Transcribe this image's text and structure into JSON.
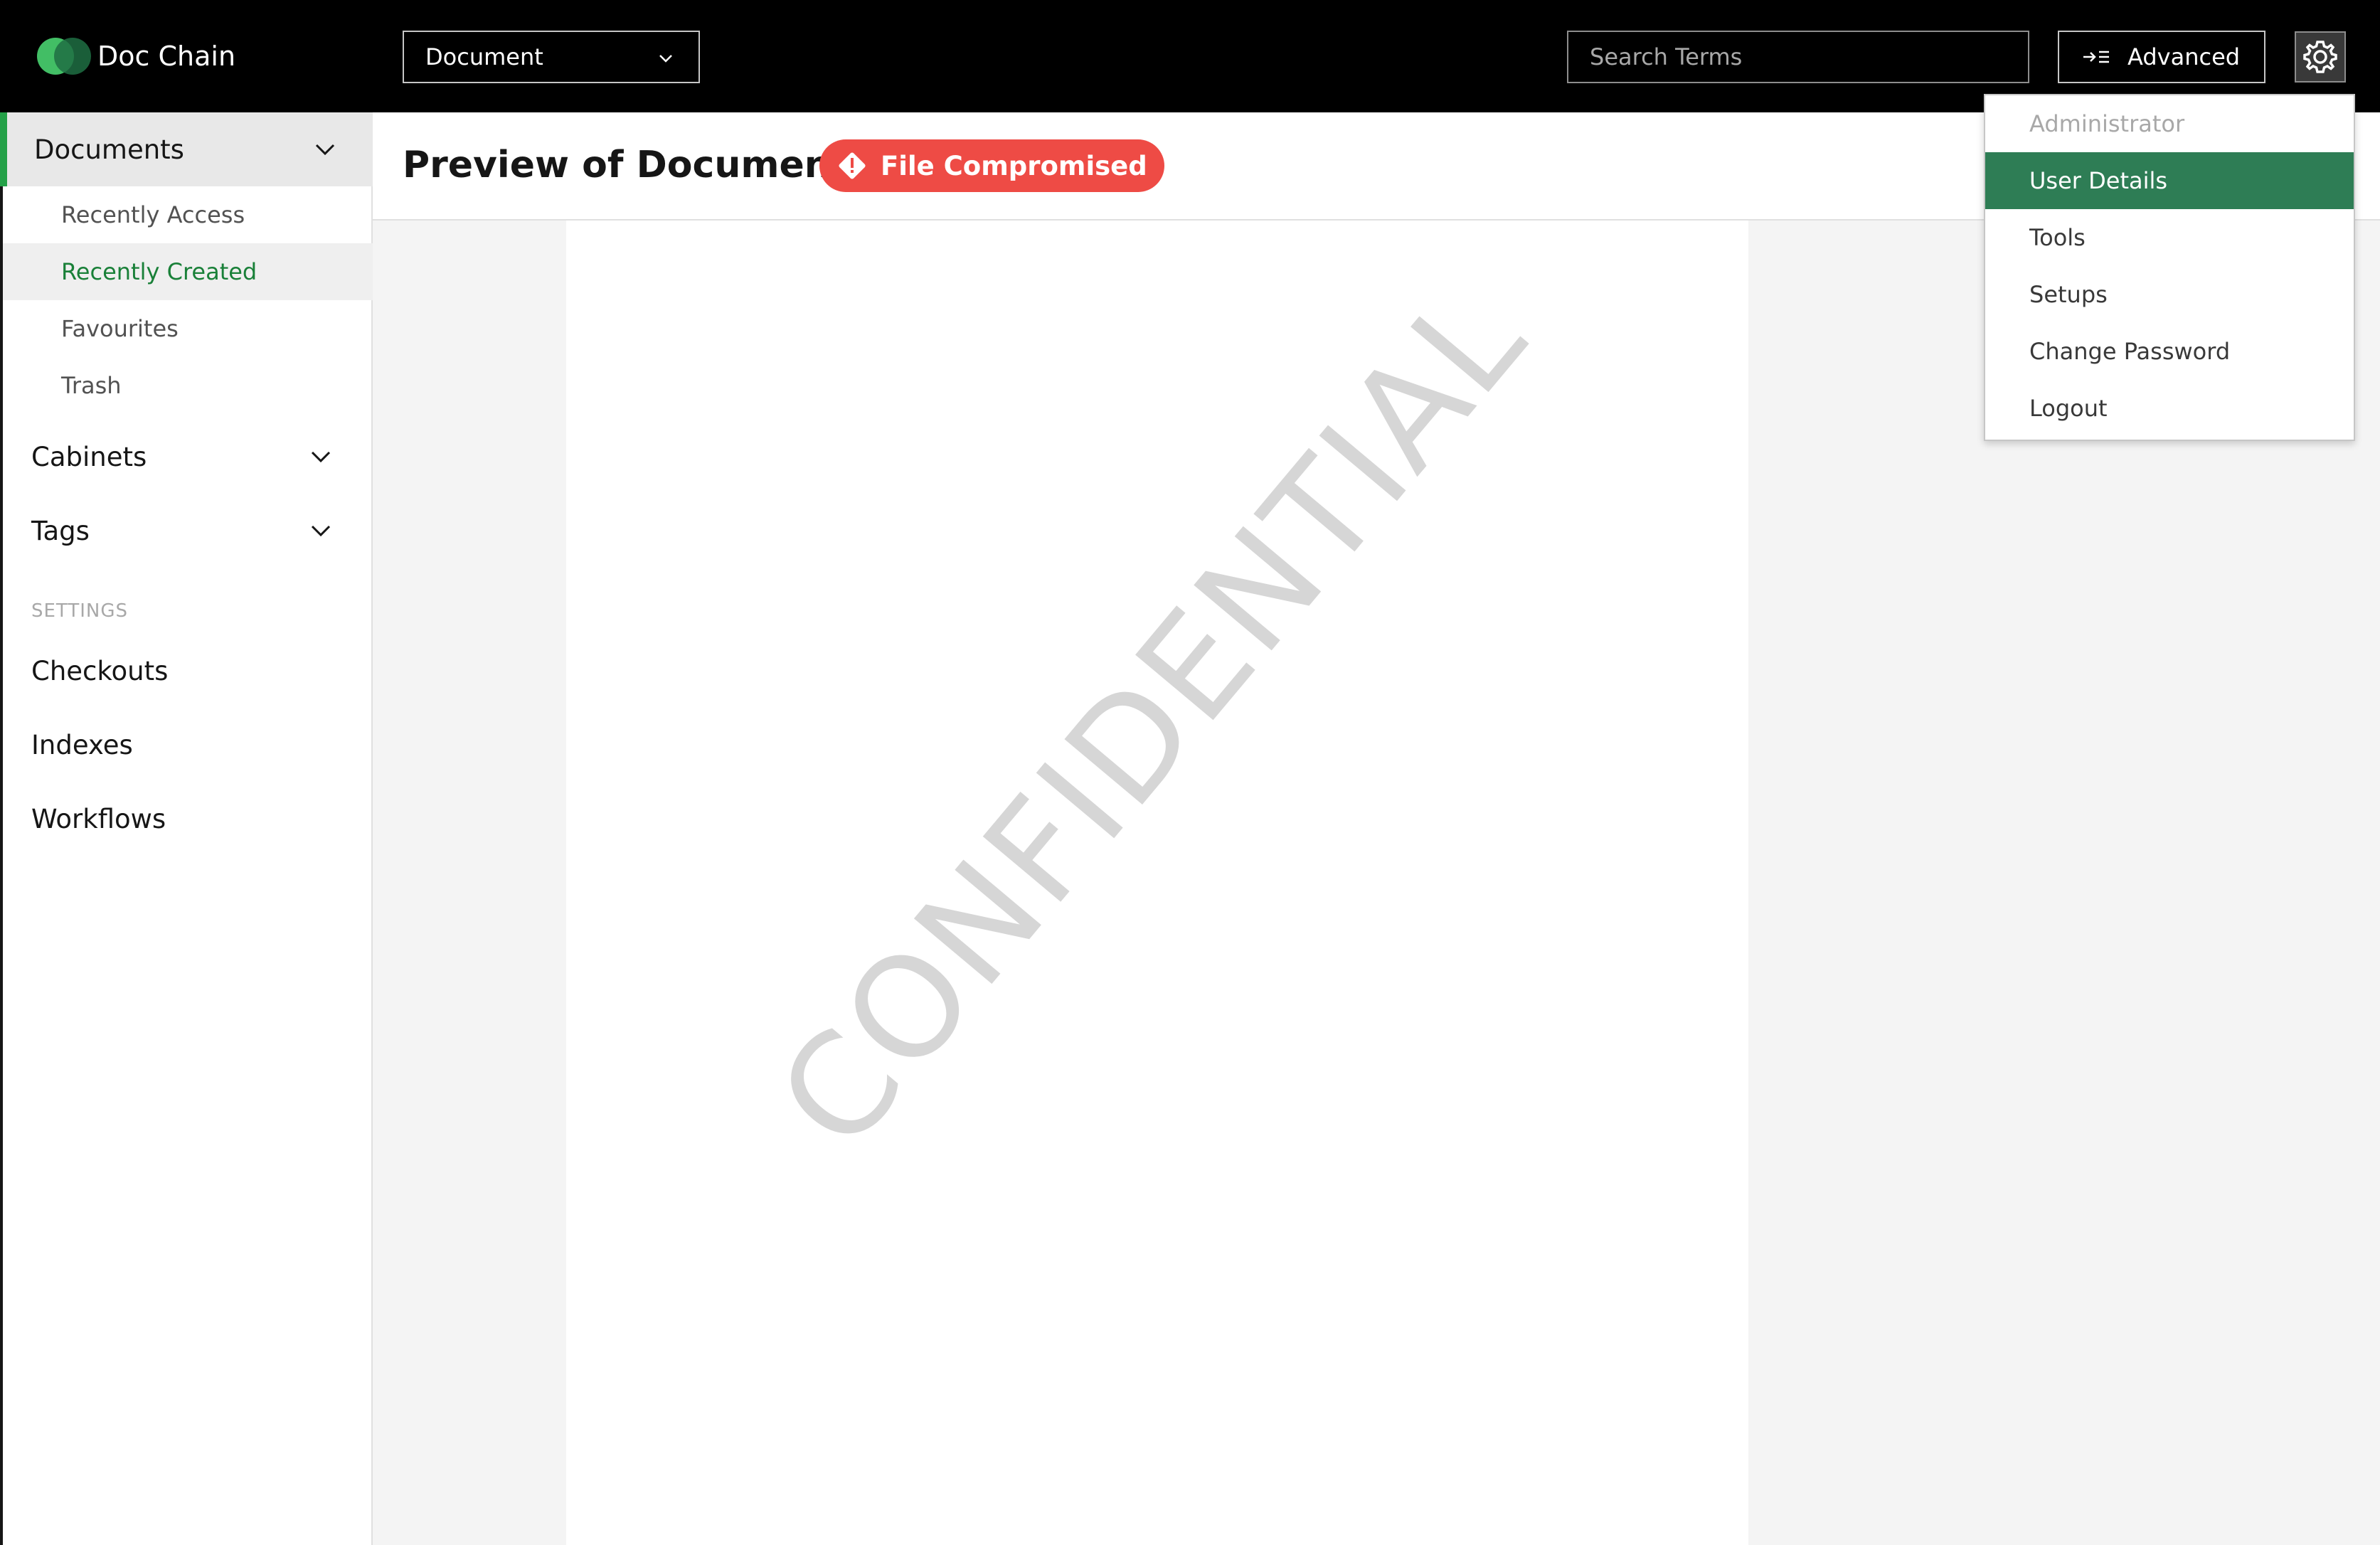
{
  "header": {
    "brand": "Doc Chain",
    "doc_type_select": "Document",
    "search_placeholder": "Search Terms",
    "advanced_label": "Advanced"
  },
  "sidebar": {
    "groups": [
      {
        "label": "Documents",
        "expanded": true,
        "items": [
          {
            "label": "Recently Access"
          },
          {
            "label": "Recently Created",
            "selected": true
          },
          {
            "label": "Favourites"
          },
          {
            "label": "Trash"
          }
        ]
      },
      {
        "label": "Cabinets"
      },
      {
        "label": "Tags"
      }
    ],
    "section_title": "SETTINGS",
    "settings_items": [
      "Checkouts",
      "Indexes",
      "Workflows"
    ]
  },
  "main": {
    "title": "Preview of Document",
    "status_badge": "File Compromised",
    "watermark": "CONFIDENTIAL"
  },
  "user_menu": {
    "items": [
      {
        "label": "Administrator",
        "disabled": true
      },
      {
        "label": "User Details",
        "highlighted": true
      },
      {
        "label": "Tools"
      },
      {
        "label": "Setups"
      },
      {
        "label": "Change Password"
      },
      {
        "label": "Logout"
      }
    ]
  },
  "colors": {
    "header_bg": "#000000",
    "accent_green": "#24a148",
    "menu_highlight": "#2e7d55",
    "badge_red": "#ee4b45"
  }
}
